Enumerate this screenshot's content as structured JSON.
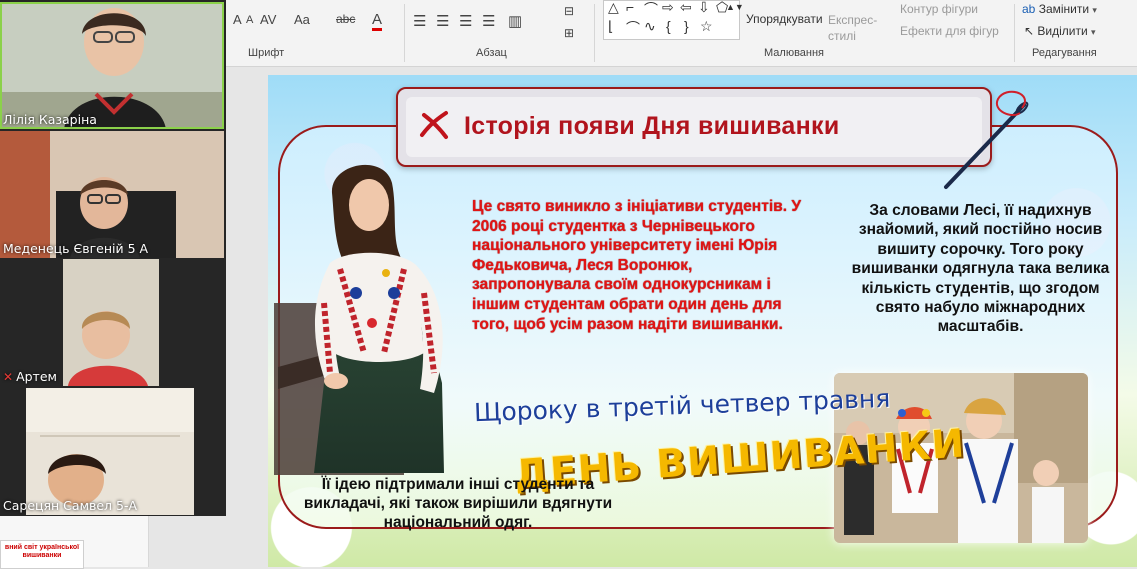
{
  "ribbon": {
    "font_group_label": "Шрифт",
    "paragraph_group_label": "Абзац",
    "drawing_group_label": "Малювання",
    "editing_group_label": "Редагування",
    "arrange_label": "Упорядкувати",
    "quick_styles_label": "Експрес-\nстилі",
    "shape_outline_label": "Контур фігури",
    "shape_effects_label": "Ефекти для фігур",
    "replace_label": "Замінити",
    "select_label": "Виділити",
    "font_glyphs": {
      "size_up": "A",
      "size_down": "A",
      "spacing": "AV",
      "case": "Aa",
      "clear": "abc",
      "color": "A"
    }
  },
  "slide": {
    "title": "Історія появи Дня вишиванки",
    "left_text": "Це свято виникло з ініціативи студентів. У 2006 році студентка з Чернівецького національного університету імені Юрія Федьковича, Леся Воронюк, запропонувала своїм однокурсникам і іншим студентам обрати один день для того, щоб усім разом надіти вишиванки.",
    "right_text": "За словами Лесі, її надихнув знайомий, який постійно носив вишиту сорочку. Того року вишиванки одягнула така велика кількість студентів, що згодом свято набуло міжнародних масштабів.",
    "bottom_text": "Її ідею підтримали інші студенти та викладачі, які також вирішили вдягнути національний одяг.",
    "wordart_line1": "Щороку в третій четвер травня",
    "wordart_line2": "ДЕНЬ ВИШИВАНКИ",
    "title_color": "#b1141d",
    "left_text_color": "#e11414",
    "frame_color": "#9b1b1b"
  },
  "thumbnail": {
    "text": "вний світ української\nвишиванки"
  },
  "participants": [
    {
      "name": "Лілія Казаріна",
      "active": true,
      "muted": false
    },
    {
      "name": "Меденець Євгеній 5 А",
      "active": false,
      "muted": false
    },
    {
      "name": "Артем",
      "active": false,
      "muted": true
    },
    {
      "name": "Сарецян Самвел 5-А",
      "active": false,
      "muted": false
    }
  ]
}
